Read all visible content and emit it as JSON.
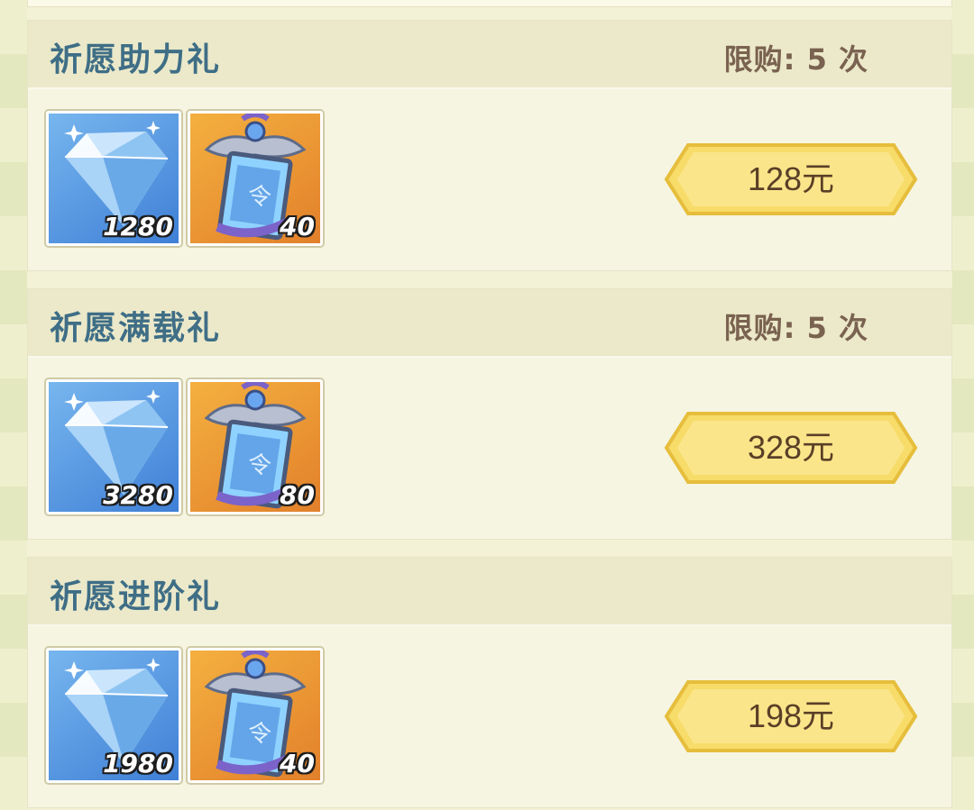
{
  "packs": [
    {
      "title": "祈愿助力礼",
      "limit": "限购: 5 次",
      "items": [
        {
          "icon": "gem-icon",
          "qty": "1280"
        },
        {
          "icon": "wish-token-icon",
          "qty": "40"
        }
      ],
      "price": "128元"
    },
    {
      "title": "祈愿满载礼",
      "limit": "限购: 5 次",
      "items": [
        {
          "icon": "gem-icon",
          "qty": "3280"
        },
        {
          "icon": "wish-token-icon",
          "qty": "80"
        }
      ],
      "price": "328元"
    },
    {
      "title": "祈愿进阶礼",
      "limit": "",
      "items": [
        {
          "icon": "gem-icon",
          "qty": "1980"
        },
        {
          "icon": "wish-token-icon",
          "qty": "40"
        }
      ],
      "price": "198元"
    }
  ],
  "colors": {
    "title": "#3f6e86",
    "limit": "#7a6250",
    "button": "#f7dc6a",
    "background": "#f3f1d6"
  }
}
